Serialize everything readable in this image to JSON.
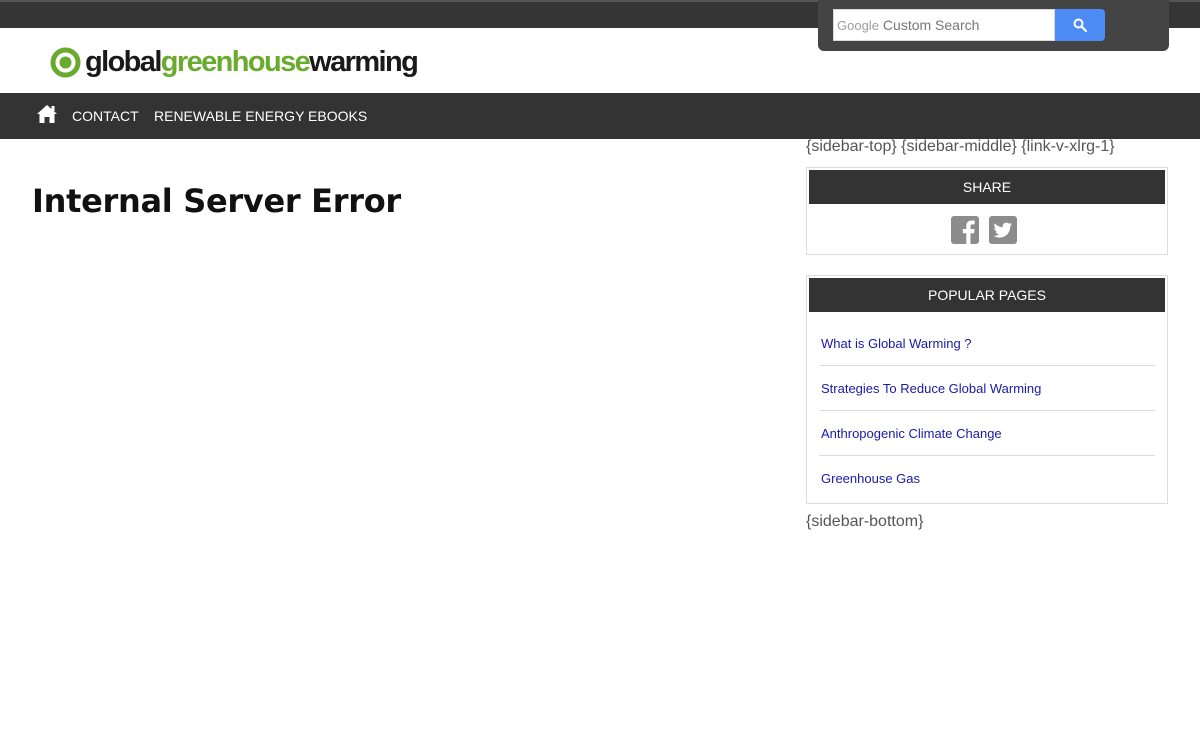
{
  "search": {
    "google_label": "Google",
    "placeholder": "Custom Search",
    "button_icon": "search-icon",
    "button_color": "#4d8cf5"
  },
  "logo": {
    "part1": "global",
    "part2": "greenhouse",
    "part3": "warming",
    "brand_green": "#6aaa2e"
  },
  "nav": {
    "home_icon": "home-icon",
    "items": [
      {
        "label": "CONTACT"
      },
      {
        "label": "RENEWABLE ENERGY EBOOKS"
      }
    ]
  },
  "main": {
    "title": "Internal Server Error"
  },
  "sidebar": {
    "top_placeholder": "{sidebar-top} {sidebar-middle} {link-v-xlrg-1}",
    "share": {
      "heading": "SHARE",
      "icons": [
        "facebook-icon",
        "twitter-icon"
      ]
    },
    "popular": {
      "heading": "POPULAR PAGES",
      "links": [
        {
          "label": "What is Global Warming ?"
        },
        {
          "label": "Strategies To Reduce Global Warming"
        },
        {
          "label": "Anthropogenic Climate Change"
        },
        {
          "label": "Greenhouse Gas"
        }
      ]
    },
    "bottom_placeholder": "{sidebar-bottom}"
  }
}
